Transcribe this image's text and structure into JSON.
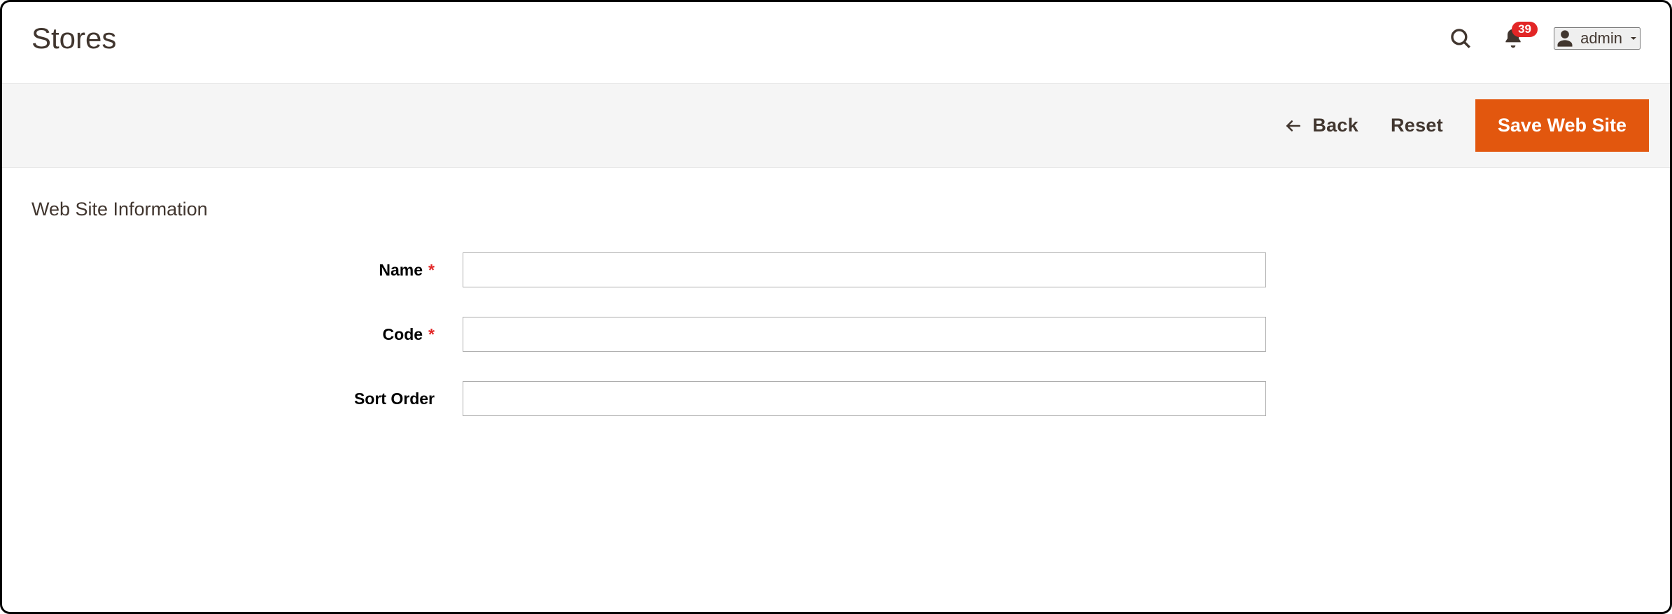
{
  "colors": {
    "accent": "#e2570e",
    "danger": "#e22626"
  },
  "header": {
    "title": "Stores",
    "notifications_count": "39",
    "user_label": "admin"
  },
  "actions": {
    "back_label": "Back",
    "reset_label": "Reset",
    "save_label": "Save Web Site"
  },
  "section": {
    "title": "Web Site Information",
    "fields": {
      "name": {
        "label": "Name",
        "value": "",
        "required": true
      },
      "code": {
        "label": "Code",
        "value": "",
        "required": true
      },
      "order": {
        "label": "Sort Order",
        "value": "",
        "required": false
      }
    }
  }
}
